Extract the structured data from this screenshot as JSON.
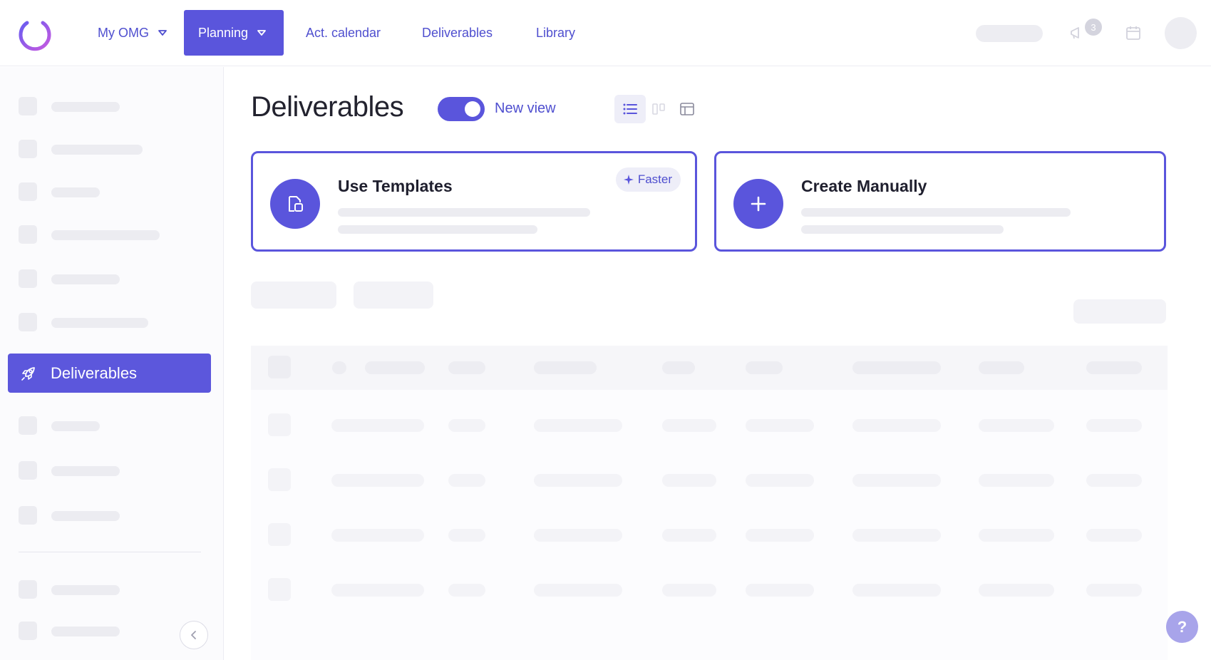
{
  "nav": {
    "items": [
      {
        "label": "My OMG",
        "has_dropdown": true,
        "active": false
      },
      {
        "label": "Planning",
        "has_dropdown": true,
        "active": true
      },
      {
        "label": "Act. calendar",
        "has_dropdown": false,
        "active": false
      },
      {
        "label": "Deliverables",
        "has_dropdown": false,
        "active": false
      },
      {
        "label": "Library",
        "has_dropdown": false,
        "active": false
      }
    ],
    "notification_count": "3"
  },
  "sidebar": {
    "active_item": {
      "label": "Deliverables",
      "icon": "rocket-icon"
    }
  },
  "main": {
    "title": "Deliverables",
    "toggle": {
      "label": "New view",
      "on": true
    },
    "view_modes": [
      "list-view-icon",
      "kanban-view-icon",
      "table-layout-icon"
    ],
    "cards": [
      {
        "title": "Use Templates",
        "icon": "template-icon",
        "badge": "Faster"
      },
      {
        "title": "Create Manually",
        "icon": "plus-icon"
      }
    ]
  },
  "help": {
    "label": "?"
  },
  "colors": {
    "accent": "#5a55dc",
    "accent_text": "#4f4fcf",
    "skeleton": "#ececf1"
  }
}
